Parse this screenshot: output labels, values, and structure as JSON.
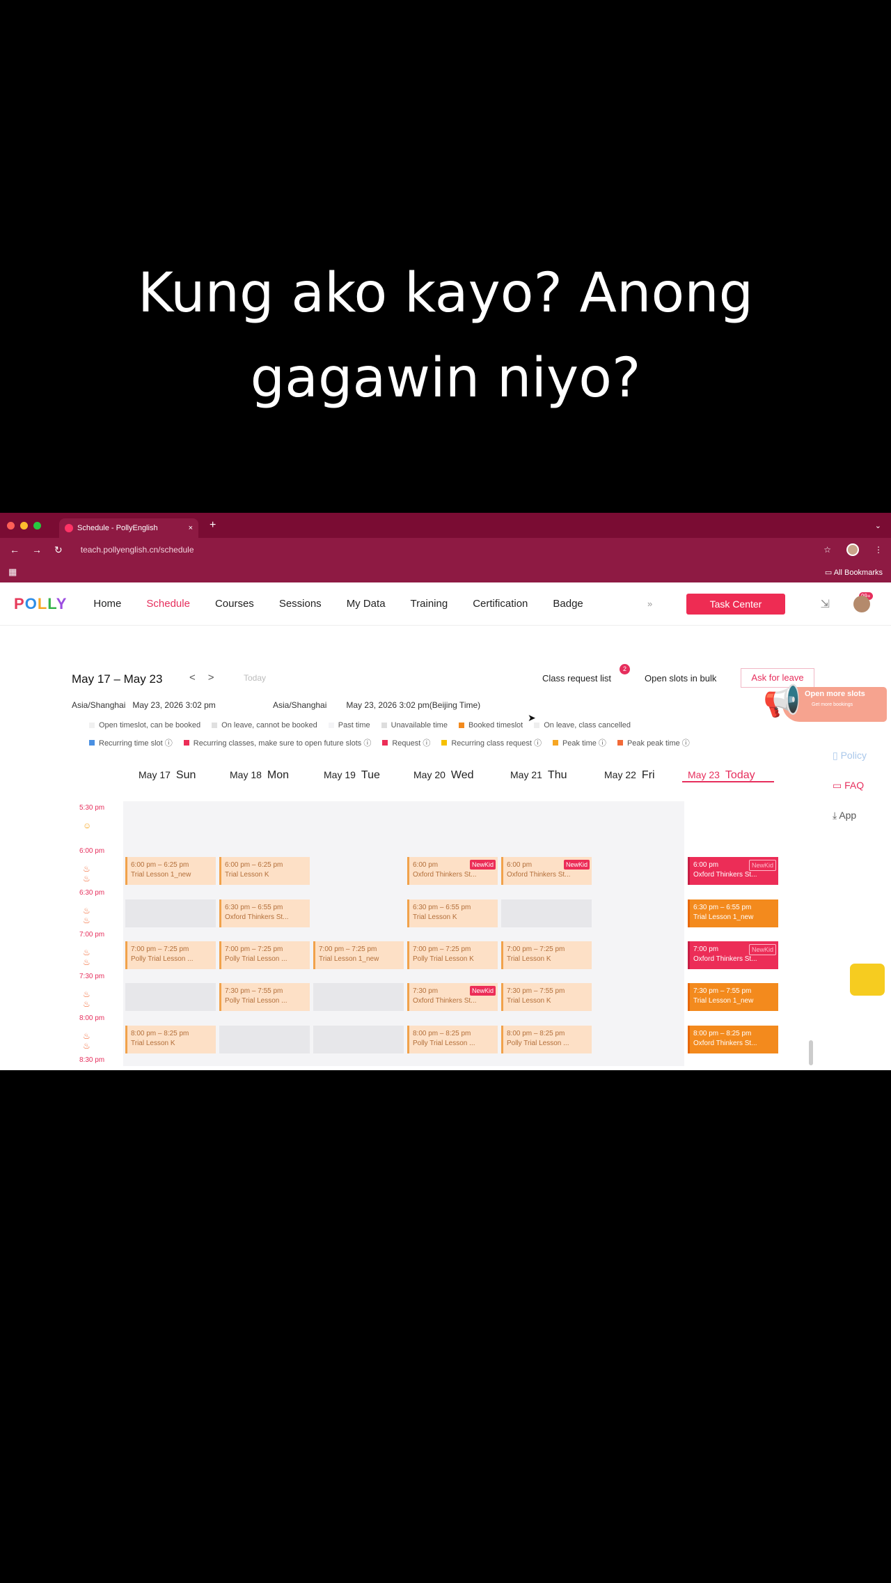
{
  "caption": {
    "line1": "Kung ako kayo? Anong",
    "line2": "gagawin niyo?"
  },
  "browser": {
    "tab_title": "Schedule - PollyEnglish",
    "tab_close": "×",
    "new_tab": "+",
    "url": "teach.pollyenglish.cn/schedule",
    "all_bookmarks": "All Bookmarks",
    "traffic_colors": [
      "#ff5f57",
      "#febc2e",
      "#28c840"
    ]
  },
  "site": {
    "logo": [
      "P",
      "O",
      "L",
      "L",
      "Y"
    ],
    "nav": [
      {
        "label": "Home"
      },
      {
        "label": "Schedule",
        "active": true
      },
      {
        "label": "Courses"
      },
      {
        "label": "Sessions"
      },
      {
        "label": "My Data"
      },
      {
        "label": "Training"
      },
      {
        "label": "Certification"
      },
      {
        "label": "Badge"
      }
    ],
    "nav_more": "»",
    "task_center": "Task Center",
    "notif_badge": "99+",
    "accent": "#e62e5c"
  },
  "schedule": {
    "range": "May 17 – May 23",
    "prev": "<",
    "next": ">",
    "today_btn": "Today",
    "tz_left_label": "Asia/Shanghai",
    "tz_left_time": "May 23, 2026 3:02 pm",
    "tz_right_label": "Asia/Shanghai",
    "tz_right_time": "May 23, 2026 3:02 pm(Beijing Time)",
    "class_request_list": "Class request list",
    "class_request_count": "2",
    "open_slots_bulk": "Open slots in bulk",
    "ask_for_leave": "Ask for leave",
    "promo_title": "Open more slots",
    "promo_sub": "Get more bookings"
  },
  "legend": {
    "row1": [
      {
        "label": "Open timeslot, can be booked",
        "color": "#f0f0f0"
      },
      {
        "label": "On leave, cannot be booked",
        "color": "#e0e0e0"
      },
      {
        "label": "Past time",
        "color": "#f4f4f6"
      },
      {
        "label": "Unavailable time",
        "color": "#ddd"
      },
      {
        "label": "Booked timeslot",
        "color": "#f38a1d"
      },
      {
        "label": "On leave, class cancelled",
        "color": "#eee"
      }
    ],
    "row2": [
      {
        "label": "Recurring time slot ⓘ",
        "color": "#4a90e2"
      },
      {
        "label": "Recurring classes, make sure to open future slots ⓘ",
        "color": "#ec2d57"
      },
      {
        "label": "Request ⓘ",
        "color": "#ec2d57"
      },
      {
        "label": "Recurring class request ⓘ",
        "color": "#f6c000"
      },
      {
        "label": "Peak time ⓘ",
        "color": "#f6a623"
      },
      {
        "label": "Peak peak time ⓘ",
        "color": "#f26a38"
      }
    ]
  },
  "side_tools": {
    "policy": "Policy",
    "faq": "FAQ",
    "app": "App"
  },
  "days": [
    {
      "date": "May 17",
      "dow": "Sun"
    },
    {
      "date": "May 18",
      "dow": "Mon"
    },
    {
      "date": "May 19",
      "dow": "Tue"
    },
    {
      "date": "May 20",
      "dow": "Wed"
    },
    {
      "date": "May 21",
      "dow": "Thu"
    },
    {
      "date": "May 22",
      "dow": "Fri"
    },
    {
      "date": "May 23",
      "dow": "Today"
    }
  ],
  "times": [
    "5:30 pm",
    "6:00 pm",
    "6:30 pm",
    "7:00 pm",
    "7:30 pm",
    "8:00 pm",
    "8:30 pm"
  ],
  "events": [
    {
      "day": 0,
      "slot": 1,
      "time": "6:00 pm – 6:25 pm",
      "name": "Trial Lesson 1_new",
      "style": "light"
    },
    {
      "day": 1,
      "slot": 1,
      "time": "6:00 pm – 6:25 pm",
      "name": "Trial Lesson K",
      "style": "light"
    },
    {
      "day": 3,
      "slot": 1,
      "time": "6:00 pm",
      "name": "Oxford Thinkers St...",
      "style": "light",
      "tag": "NewKid"
    },
    {
      "day": 4,
      "slot": 1,
      "time": "6:00 pm",
      "name": "Oxford Thinkers St...",
      "style": "light",
      "tag": "NewKid"
    },
    {
      "day": 6,
      "slot": 1,
      "time": "6:00 pm",
      "name": "Oxford Thinkers St...",
      "style": "red",
      "tag": "NewKid"
    },
    {
      "day": 1,
      "slot": 2,
      "time": "6:30 pm – 6:55 pm",
      "name": "Oxford Thinkers St...",
      "style": "light"
    },
    {
      "day": 3,
      "slot": 2,
      "time": "6:30 pm – 6:55 pm",
      "name": "Trial Lesson K",
      "style": "light"
    },
    {
      "day": 6,
      "slot": 2,
      "time": "6:30 pm – 6:55 pm",
      "name": "Trial Lesson 1_new",
      "style": "dark"
    },
    {
      "day": 0,
      "slot": 3,
      "time": "7:00 pm – 7:25 pm",
      "name": "Polly Trial Lesson ...",
      "style": "light"
    },
    {
      "day": 1,
      "slot": 3,
      "time": "7:00 pm – 7:25 pm",
      "name": "Polly Trial Lesson ...",
      "style": "light"
    },
    {
      "day": 2,
      "slot": 3,
      "time": "7:00 pm – 7:25 pm",
      "name": "Trial Lesson 1_new",
      "style": "light"
    },
    {
      "day": 3,
      "slot": 3,
      "time": "7:00 pm – 7:25 pm",
      "name": "Polly Trial Lesson K",
      "style": "light"
    },
    {
      "day": 4,
      "slot": 3,
      "time": "7:00 pm – 7:25 pm",
      "name": "Trial Lesson K",
      "style": "light"
    },
    {
      "day": 6,
      "slot": 3,
      "time": "7:00 pm",
      "name": "Oxford Thinkers St...",
      "style": "red",
      "tag": "NewKid"
    },
    {
      "day": 1,
      "slot": 4,
      "time": "7:30 pm – 7:55 pm",
      "name": "Polly Trial Lesson ...",
      "style": "light"
    },
    {
      "day": 3,
      "slot": 4,
      "time": "7:30 pm",
      "name": "Oxford Thinkers St...",
      "style": "light",
      "tag": "NewKid"
    },
    {
      "day": 4,
      "slot": 4,
      "time": "7:30 pm – 7:55 pm",
      "name": "Trial Lesson K",
      "style": "light"
    },
    {
      "day": 6,
      "slot": 4,
      "time": "7:30 pm – 7:55 pm",
      "name": "Trial Lesson 1_new",
      "style": "dark"
    },
    {
      "day": 0,
      "slot": 5,
      "time": "8:00 pm – 8:25 pm",
      "name": "Trial Lesson K",
      "style": "light"
    },
    {
      "day": 3,
      "slot": 5,
      "time": "8:00 pm – 8:25 pm",
      "name": "Polly Trial Lesson ...",
      "style": "light"
    },
    {
      "day": 4,
      "slot": 5,
      "time": "8:00 pm – 8:25 pm",
      "name": "Polly Trial Lesson ...",
      "style": "light"
    },
    {
      "day": 6,
      "slot": 5,
      "time": "8:00 pm – 8:25 pm",
      "name": "Oxford Thinkers St...",
      "style": "dark"
    }
  ],
  "grey_slots": [
    {
      "day": 0,
      "slot": 2
    },
    {
      "day": 4,
      "slot": 2
    },
    {
      "day": 0,
      "slot": 4
    },
    {
      "day": 2,
      "slot": 4
    },
    {
      "day": 1,
      "slot": 5
    },
    {
      "day": 2,
      "slot": 5
    }
  ]
}
